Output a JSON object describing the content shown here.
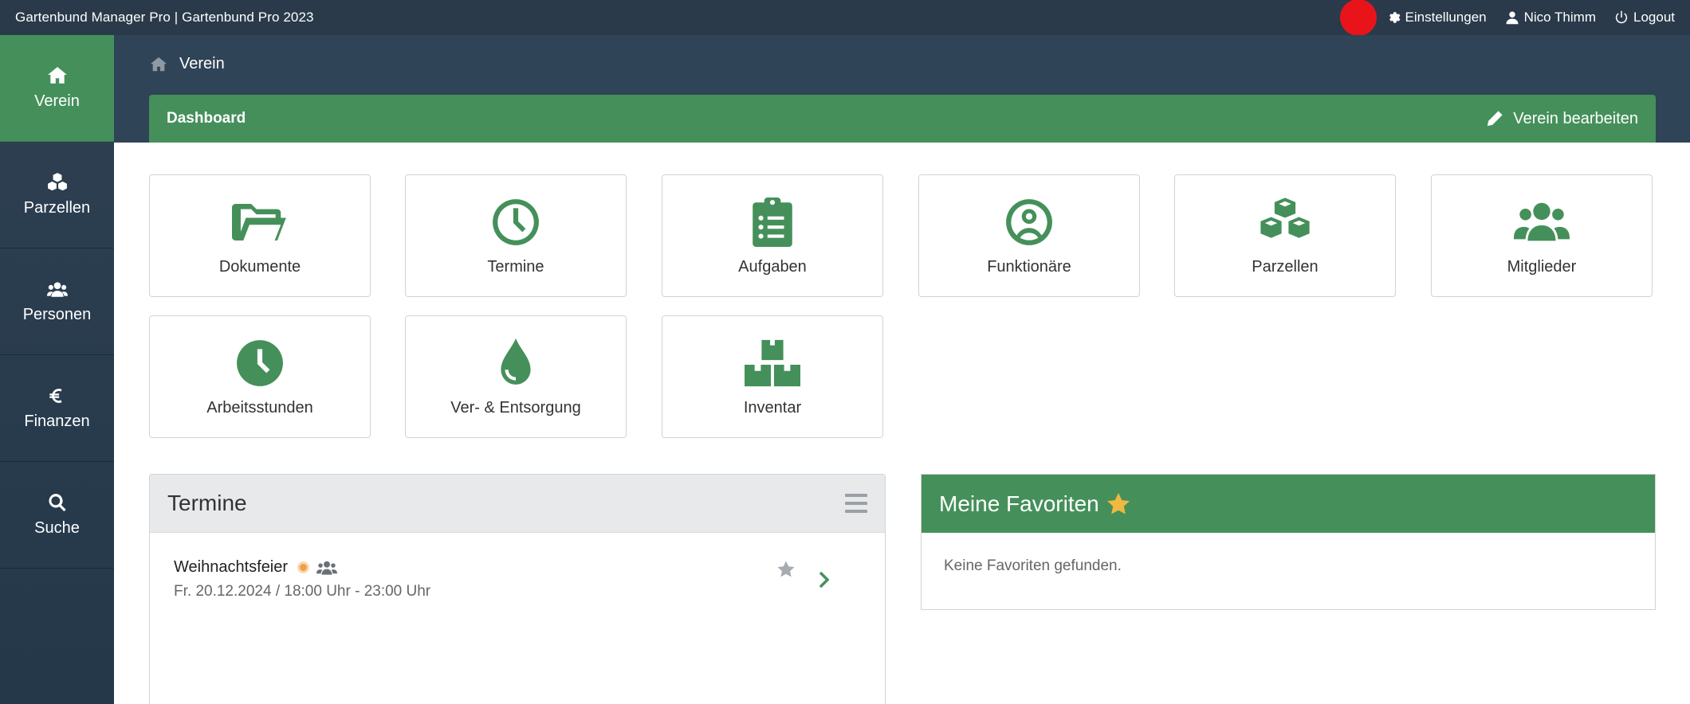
{
  "topbar": {
    "app_title": "Gartenbund Manager Pro | Gartenbund Pro 2023",
    "settings_label": "Einstellungen",
    "user_label": "Nico Thimm",
    "logout_label": "Logout",
    "record_dot_color": "#e8141a"
  },
  "sidebar": {
    "items": [
      {
        "label": "Verein",
        "icon": "home-icon",
        "active": true
      },
      {
        "label": "Parzellen",
        "icon": "cubes-icon"
      },
      {
        "label": "Personen",
        "icon": "users-icon"
      },
      {
        "label": "Finanzen",
        "icon": "euro-icon"
      },
      {
        "label": "Suche",
        "icon": "search-icon"
      }
    ]
  },
  "header": {
    "breadcrumb": "Verein",
    "dashboard_title": "Dashboard",
    "edit_label": "Verein bearbeiten"
  },
  "tiles": [
    {
      "label": "Dokumente",
      "icon": "folder-open-icon"
    },
    {
      "label": "Termine",
      "icon": "clock-icon"
    },
    {
      "label": "Aufgaben",
      "icon": "clipboard-list-icon"
    },
    {
      "label": "Funktionäre",
      "icon": "user-circle-icon"
    },
    {
      "label": "Parzellen",
      "icon": "cubes-icon"
    },
    {
      "label": "Mitglieder",
      "icon": "users-icon"
    },
    {
      "label": "Arbeitsstunden",
      "icon": "clock-solid-icon"
    },
    {
      "label": "Ver- & Entsorgung",
      "icon": "water-drop-icon"
    },
    {
      "label": "Inventar",
      "icon": "boxes-icon"
    }
  ],
  "termine_panel": {
    "title": "Termine",
    "events": [
      {
        "name": "Weihnachtsfeier",
        "date": "Fr. 20.12.2024 / 18:00 Uhr - 23:00 Uhr"
      }
    ]
  },
  "favorites_panel": {
    "title": "Meine Favoriten",
    "empty_text": "Keine Favoriten gefunden."
  },
  "colors": {
    "accent_green": "#45905a",
    "header_dark": "#2f4456",
    "topbar": "#2a3a4a",
    "star_gold": "#f1b841"
  }
}
